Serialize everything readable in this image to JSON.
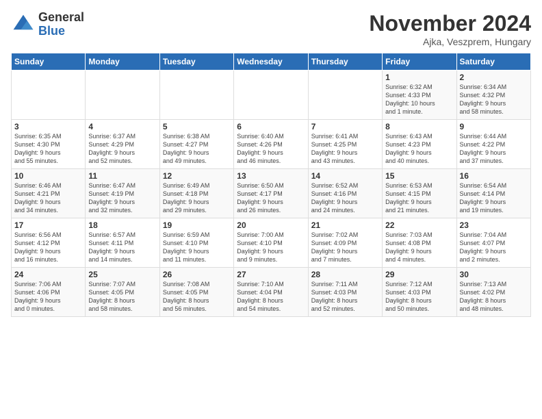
{
  "logo": {
    "general": "General",
    "blue": "Blue"
  },
  "title": "November 2024",
  "subtitle": "Ajka, Veszprem, Hungary",
  "headers": [
    "Sunday",
    "Monday",
    "Tuesday",
    "Wednesday",
    "Thursday",
    "Friday",
    "Saturday"
  ],
  "weeks": [
    [
      {
        "day": "",
        "info": ""
      },
      {
        "day": "",
        "info": ""
      },
      {
        "day": "",
        "info": ""
      },
      {
        "day": "",
        "info": ""
      },
      {
        "day": "",
        "info": ""
      },
      {
        "day": "1",
        "info": "Sunrise: 6:32 AM\nSunset: 4:33 PM\nDaylight: 10 hours\nand 1 minute."
      },
      {
        "day": "2",
        "info": "Sunrise: 6:34 AM\nSunset: 4:32 PM\nDaylight: 9 hours\nand 58 minutes."
      }
    ],
    [
      {
        "day": "3",
        "info": "Sunrise: 6:35 AM\nSunset: 4:30 PM\nDaylight: 9 hours\nand 55 minutes."
      },
      {
        "day": "4",
        "info": "Sunrise: 6:37 AM\nSunset: 4:29 PM\nDaylight: 9 hours\nand 52 minutes."
      },
      {
        "day": "5",
        "info": "Sunrise: 6:38 AM\nSunset: 4:27 PM\nDaylight: 9 hours\nand 49 minutes."
      },
      {
        "day": "6",
        "info": "Sunrise: 6:40 AM\nSunset: 4:26 PM\nDaylight: 9 hours\nand 46 minutes."
      },
      {
        "day": "7",
        "info": "Sunrise: 6:41 AM\nSunset: 4:25 PM\nDaylight: 9 hours\nand 43 minutes."
      },
      {
        "day": "8",
        "info": "Sunrise: 6:43 AM\nSunset: 4:23 PM\nDaylight: 9 hours\nand 40 minutes."
      },
      {
        "day": "9",
        "info": "Sunrise: 6:44 AM\nSunset: 4:22 PM\nDaylight: 9 hours\nand 37 minutes."
      }
    ],
    [
      {
        "day": "10",
        "info": "Sunrise: 6:46 AM\nSunset: 4:21 PM\nDaylight: 9 hours\nand 34 minutes."
      },
      {
        "day": "11",
        "info": "Sunrise: 6:47 AM\nSunset: 4:19 PM\nDaylight: 9 hours\nand 32 minutes."
      },
      {
        "day": "12",
        "info": "Sunrise: 6:49 AM\nSunset: 4:18 PM\nDaylight: 9 hours\nand 29 minutes."
      },
      {
        "day": "13",
        "info": "Sunrise: 6:50 AM\nSunset: 4:17 PM\nDaylight: 9 hours\nand 26 minutes."
      },
      {
        "day": "14",
        "info": "Sunrise: 6:52 AM\nSunset: 4:16 PM\nDaylight: 9 hours\nand 24 minutes."
      },
      {
        "day": "15",
        "info": "Sunrise: 6:53 AM\nSunset: 4:15 PM\nDaylight: 9 hours\nand 21 minutes."
      },
      {
        "day": "16",
        "info": "Sunrise: 6:54 AM\nSunset: 4:14 PM\nDaylight: 9 hours\nand 19 minutes."
      }
    ],
    [
      {
        "day": "17",
        "info": "Sunrise: 6:56 AM\nSunset: 4:12 PM\nDaylight: 9 hours\nand 16 minutes."
      },
      {
        "day": "18",
        "info": "Sunrise: 6:57 AM\nSunset: 4:11 PM\nDaylight: 9 hours\nand 14 minutes."
      },
      {
        "day": "19",
        "info": "Sunrise: 6:59 AM\nSunset: 4:10 PM\nDaylight: 9 hours\nand 11 minutes."
      },
      {
        "day": "20",
        "info": "Sunrise: 7:00 AM\nSunset: 4:10 PM\nDaylight: 9 hours\nand 9 minutes."
      },
      {
        "day": "21",
        "info": "Sunrise: 7:02 AM\nSunset: 4:09 PM\nDaylight: 9 hours\nand 7 minutes."
      },
      {
        "day": "22",
        "info": "Sunrise: 7:03 AM\nSunset: 4:08 PM\nDaylight: 9 hours\nand 4 minutes."
      },
      {
        "day": "23",
        "info": "Sunrise: 7:04 AM\nSunset: 4:07 PM\nDaylight: 9 hours\nand 2 minutes."
      }
    ],
    [
      {
        "day": "24",
        "info": "Sunrise: 7:06 AM\nSunset: 4:06 PM\nDaylight: 9 hours\nand 0 minutes."
      },
      {
        "day": "25",
        "info": "Sunrise: 7:07 AM\nSunset: 4:05 PM\nDaylight: 8 hours\nand 58 minutes."
      },
      {
        "day": "26",
        "info": "Sunrise: 7:08 AM\nSunset: 4:05 PM\nDaylight: 8 hours\nand 56 minutes."
      },
      {
        "day": "27",
        "info": "Sunrise: 7:10 AM\nSunset: 4:04 PM\nDaylight: 8 hours\nand 54 minutes."
      },
      {
        "day": "28",
        "info": "Sunrise: 7:11 AM\nSunset: 4:03 PM\nDaylight: 8 hours\nand 52 minutes."
      },
      {
        "day": "29",
        "info": "Sunrise: 7:12 AM\nSunset: 4:03 PM\nDaylight: 8 hours\nand 50 minutes."
      },
      {
        "day": "30",
        "info": "Sunrise: 7:13 AM\nSunset: 4:02 PM\nDaylight: 8 hours\nand 48 minutes."
      }
    ]
  ]
}
